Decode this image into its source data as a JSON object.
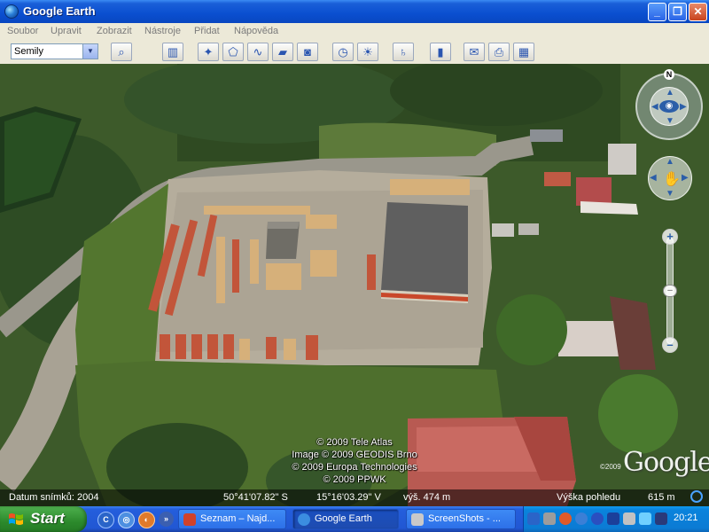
{
  "window": {
    "title": "Google Earth"
  },
  "menu": [
    "Soubor",
    "Upravit",
    "Zobrazit",
    "Nástroje",
    "Přidat",
    "Nápověda"
  ],
  "toolbar": {
    "search_value": "Semily",
    "buttons": [
      {
        "name": "search-button",
        "icon": "magnifier-icon",
        "glyph": "⌕"
      },
      {
        "name": "sidebar-toggle-button",
        "icon": "panel-icon",
        "glyph": "▥"
      },
      {
        "name": "add-placemark-button",
        "icon": "pushpin-icon",
        "glyph": "✦"
      },
      {
        "name": "add-polygon-button",
        "icon": "polygon-icon",
        "glyph": "⬠"
      },
      {
        "name": "add-path-button",
        "icon": "path-icon",
        "glyph": "∿"
      },
      {
        "name": "add-image-overlay-button",
        "icon": "overlay-icon",
        "glyph": "▰"
      },
      {
        "name": "record-tour-button",
        "icon": "camera-icon",
        "glyph": "◙"
      },
      {
        "name": "historical-imagery-button",
        "icon": "clock-icon",
        "glyph": "◷"
      },
      {
        "name": "sunlight-button",
        "icon": "sun-icon",
        "glyph": "☀"
      },
      {
        "name": "switch-planet-button",
        "icon": "planet-icon",
        "glyph": "♄"
      },
      {
        "name": "ruler-button",
        "icon": "ruler-icon",
        "glyph": "▮"
      },
      {
        "name": "email-button",
        "icon": "envelope-icon",
        "glyph": "✉"
      },
      {
        "name": "print-button",
        "icon": "printer-icon",
        "glyph": "⎙"
      },
      {
        "name": "view-in-maps-button",
        "icon": "map-icon",
        "glyph": "▦"
      }
    ]
  },
  "map": {
    "copyright": [
      "© 2009 Tele Atlas",
      "Image © 2009 GEODIS Brno",
      "© 2009 Europa Technologies",
      "© 2009 PPWK"
    ],
    "logo_year": "©2009",
    "logo": "Google",
    "nav_north": "N",
    "status": {
      "imagery_date": "Datum snímků: 2004",
      "latitude": "50°41'07.82\" S",
      "longitude": "15°16'03.29\" V",
      "elevation": "výš.  474 m",
      "eye_alt_label": "Výška pohledu",
      "eye_alt_value": "615 m"
    }
  },
  "taskbar": {
    "start": "Start",
    "tasks": [
      {
        "label": "Seznam – Najd...",
        "icon_color": "#d0422a",
        "active": false
      },
      {
        "label": "Google Earth",
        "icon_color": "#3b8de0",
        "active": true
      },
      {
        "label": "ScreenShots - ...",
        "icon_color": "#c9c9c9",
        "active": false
      }
    ],
    "clock": "20:21"
  }
}
